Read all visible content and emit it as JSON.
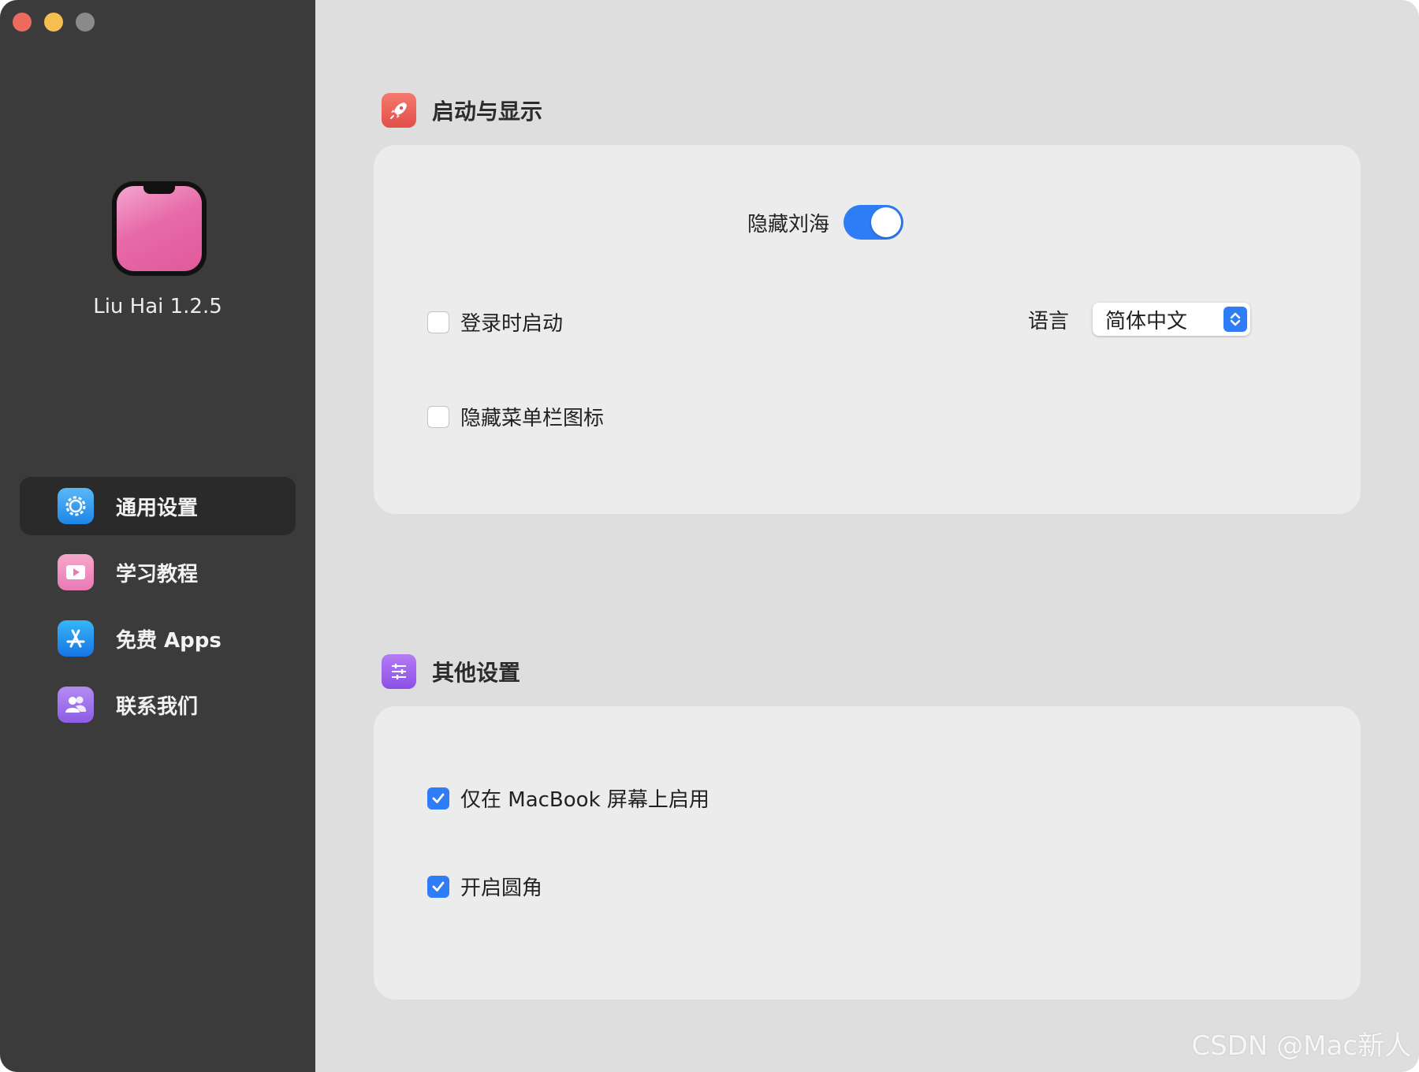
{
  "app": {
    "name": "Liu Hai 1.2.5"
  },
  "sidebar": {
    "items": [
      {
        "label": "通用设置",
        "icon": "gear-icon",
        "active": true
      },
      {
        "label": "学习教程",
        "icon": "video-icon",
        "active": false
      },
      {
        "label": "免费 Apps",
        "icon": "app-store-icon",
        "active": false
      },
      {
        "label": "联系我们",
        "icon": "people-icon",
        "active": false
      }
    ]
  },
  "sections": {
    "startup": {
      "title": "启动与显示",
      "icon": "rocket-icon",
      "toggle": {
        "label": "隐藏刘海",
        "on": true
      },
      "launch_at_login": {
        "label": "登录时启动",
        "checked": false
      },
      "hide_menubar_icon": {
        "label": "隐藏菜单栏图标",
        "checked": false
      },
      "language": {
        "label": "语言",
        "value": "简体中文"
      }
    },
    "other": {
      "title": "其他设置",
      "icon": "sliders-icon",
      "macbook_only": {
        "label": "仅在 MacBook 屏幕上启用",
        "checked": true
      },
      "rounded_corners": {
        "label": "开启圆角",
        "checked": true
      }
    }
  },
  "watermark": "CSDN @Mac新人",
  "colors": {
    "accent": "#2f7df6",
    "sidebar_bg": "#3b3b3b",
    "content_bg": "#dedede",
    "card_bg": "#ececec"
  }
}
